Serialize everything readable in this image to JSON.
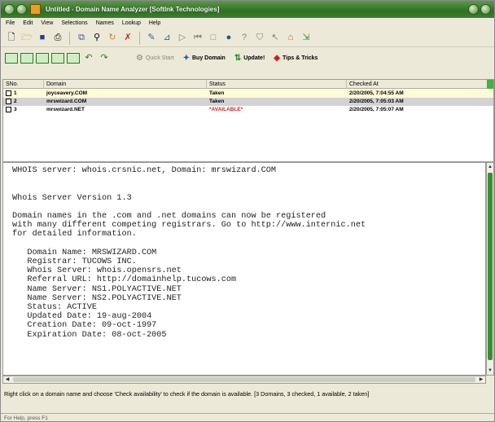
{
  "window": {
    "title": "Untitled - Domain Name Analyzer [SoftInk Technologies]"
  },
  "menu": {
    "items": [
      "File",
      "Edit",
      "View",
      "Selections",
      "Names",
      "Lookup",
      "Help"
    ]
  },
  "toolbar2": {
    "quick_start": "Quick Start",
    "buy_domain": "Buy Domain",
    "update": "Update!",
    "tips": "Tips & Tricks"
  },
  "list": {
    "columns": [
      "SNo.",
      "Domain",
      "Status",
      "Checked At"
    ],
    "rows": [
      {
        "no": "1",
        "domain": "joyceavery.COM",
        "status": "Taken",
        "checked": "2/20/2005, 7:04:55 AM"
      },
      {
        "no": "2",
        "domain": "mrswizard.COM",
        "status": "Taken",
        "checked": "2/20/2005, 7:05:03 AM"
      },
      {
        "no": "3",
        "domain": "mrswizard.NET",
        "status": "*AVAILABLE*",
        "checked": "2/20/2005, 7:05:07 AM"
      }
    ]
  },
  "whois": {
    "text": "WHOIS server: whois.crsnic.net, Domain: mrswizard.COM\n\n\nWhois Server Version 1.3\n\nDomain names in the .com and .net domains can now be registered\nwith many different competing registrars. Go to http://www.internic.net\nfor detailed information.\n\n   Domain Name: MRSWIZARD.COM\n   Registrar: TUCOWS INC.\n   Whois Server: whois.opensrs.net\n   Referral URL: http://domainhelp.tucows.com\n   Name Server: NS1.POLYACTIVE.NET\n   Name Server: NS2.POLYACTIVE.NET\n   Status: ACTIVE\n   Updated Date: 19-aug-2004\n   Creation Date: 09-oct-1997\n   Expiration Date: 08-oct-2005"
  },
  "hint": "Right click on a domain name and choose 'Check availability' to check if the domain is available. [3 Domains, 3 checked, 1 available, 2 taken]",
  "statusbar": "For Help, press F1",
  "colors": {
    "titlebar": "#2f6f22",
    "available": "#d02020",
    "accent_green": "#3a8f30"
  }
}
